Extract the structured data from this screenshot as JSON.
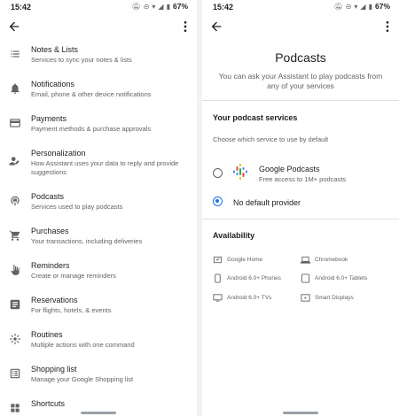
{
  "status": {
    "time": "15:42",
    "battery": "67%"
  },
  "left": {
    "items": [
      {
        "title": "Notes & Lists",
        "subtitle": "Services to sync your notes & lists",
        "icon": "notes-list-icon"
      },
      {
        "title": "Notifications",
        "subtitle": "Email, phone & other device notifications",
        "icon": "bell-icon"
      },
      {
        "title": "Payments",
        "subtitle": "Payment methods & purchase approvals",
        "icon": "credit-card-icon"
      },
      {
        "title": "Personalization",
        "subtitle": "How Assistant uses your data to reply and provide suggestions",
        "icon": "person-edit-icon"
      },
      {
        "title": "Podcasts",
        "subtitle": "Services used to play podcasts",
        "icon": "podcast-icon"
      },
      {
        "title": "Purchases",
        "subtitle": "Your transactions, including deliveries",
        "icon": "cart-icon"
      },
      {
        "title": "Reminders",
        "subtitle": "Create or manage reminders",
        "icon": "reminder-hand-icon"
      },
      {
        "title": "Reservations",
        "subtitle": "For flights, hotels, & events",
        "icon": "reservation-icon"
      },
      {
        "title": "Routines",
        "subtitle": "Multiple actions with one command",
        "icon": "routines-icon"
      },
      {
        "title": "Shopping list",
        "subtitle": "Manage your Google Shopping list",
        "icon": "shopping-list-icon"
      },
      {
        "title": "Shortcuts",
        "subtitle": "",
        "icon": "shortcuts-icon"
      }
    ]
  },
  "right": {
    "title": "Podcasts",
    "subtitle": "You can ask your Assistant to play podcasts from any of your services",
    "services_heading": "Your podcast services",
    "services_hint": "Choose which service to use by default",
    "options": [
      {
        "title": "Google Podcasts",
        "subtitle": "Free access to 1M+ podcasts",
        "selected": false
      },
      {
        "title": "No default provider",
        "subtitle": "",
        "selected": true
      }
    ],
    "availability_heading": "Availability",
    "availability": [
      {
        "label": "Google Home",
        "icon": "google-home-icon"
      },
      {
        "label": "Chromebook",
        "icon": "laptop-icon"
      },
      {
        "label": "Android 6.0+ Phones",
        "icon": "phone-icon"
      },
      {
        "label": "Android 6.0+ Tablets",
        "icon": "tablet-icon"
      },
      {
        "label": "Android 6.0+ TVs",
        "icon": "tv-icon"
      },
      {
        "label": "Smart Displays",
        "icon": "smart-display-icon"
      }
    ]
  },
  "colors": {
    "accent": "#1a73e8",
    "text": "#202124",
    "secondary": "#5f6368"
  }
}
